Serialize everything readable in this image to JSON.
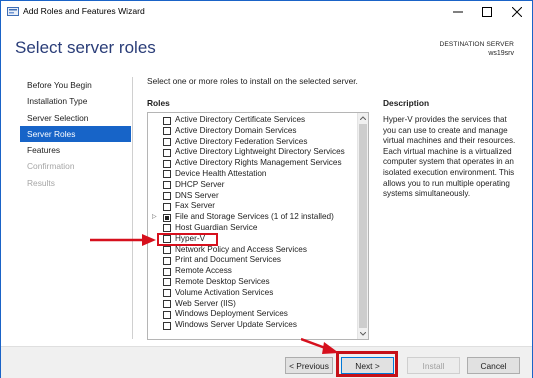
{
  "window": {
    "title": "Add Roles and Features Wizard",
    "accent_color": "#1764c8",
    "title_color": "#2a3d78"
  },
  "header": {
    "page_title": "Select server roles",
    "destination_label": "DESTINATION SERVER",
    "destination_value": "ws19srv"
  },
  "nav": {
    "items": [
      {
        "label": "Before You Begin",
        "state": "normal"
      },
      {
        "label": "Installation Type",
        "state": "normal"
      },
      {
        "label": "Server Selection",
        "state": "normal"
      },
      {
        "label": "Server Roles",
        "state": "active"
      },
      {
        "label": "Features",
        "state": "normal"
      },
      {
        "label": "Confirmation",
        "state": "disabled"
      },
      {
        "label": "Results",
        "state": "disabled"
      }
    ]
  },
  "main": {
    "instruction": "Select one or more roles to install on the selected server.",
    "roles_heading": "Roles",
    "description_heading": "Description",
    "description_text": "Hyper-V provides the services that you can use to create and manage virtual machines and their resources. Each virtual machine is a virtualized computer system that operates in an isolated execution environment. This allows you to run multiple operating systems simultaneously."
  },
  "roles": [
    {
      "label": "Active Directory Certificate Services",
      "checked": false
    },
    {
      "label": "Active Directory Domain Services",
      "checked": false
    },
    {
      "label": "Active Directory Federation Services",
      "checked": false
    },
    {
      "label": "Active Directory Lightweight Directory Services",
      "checked": false
    },
    {
      "label": "Active Directory Rights Management Services",
      "checked": false
    },
    {
      "label": "Device Health Attestation",
      "checked": false
    },
    {
      "label": "DHCP Server",
      "checked": false
    },
    {
      "label": "DNS Server",
      "checked": false
    },
    {
      "label": "Fax Server",
      "checked": false
    },
    {
      "label": "File and Storage Services (1 of 12 installed)",
      "checked": "partial",
      "expandable": true
    },
    {
      "label": "Host Guardian Service",
      "checked": false
    },
    {
      "label": "Hyper-V",
      "checked": false,
      "highlighted": true
    },
    {
      "label": "Network Policy and Access Services",
      "checked": false
    },
    {
      "label": "Print and Document Services",
      "checked": false
    },
    {
      "label": "Remote Access",
      "checked": false
    },
    {
      "label": "Remote Desktop Services",
      "checked": false
    },
    {
      "label": "Volume Activation Services",
      "checked": false
    },
    {
      "label": "Web Server (IIS)",
      "checked": false
    },
    {
      "label": "Windows Deployment Services",
      "checked": false
    },
    {
      "label": "Windows Server Update Services",
      "checked": false
    }
  ],
  "footer": {
    "previous_label": "< Previous",
    "next_label": "Next >",
    "install_label": "Install",
    "cancel_label": "Cancel"
  },
  "annotation_color": "#d6101d"
}
